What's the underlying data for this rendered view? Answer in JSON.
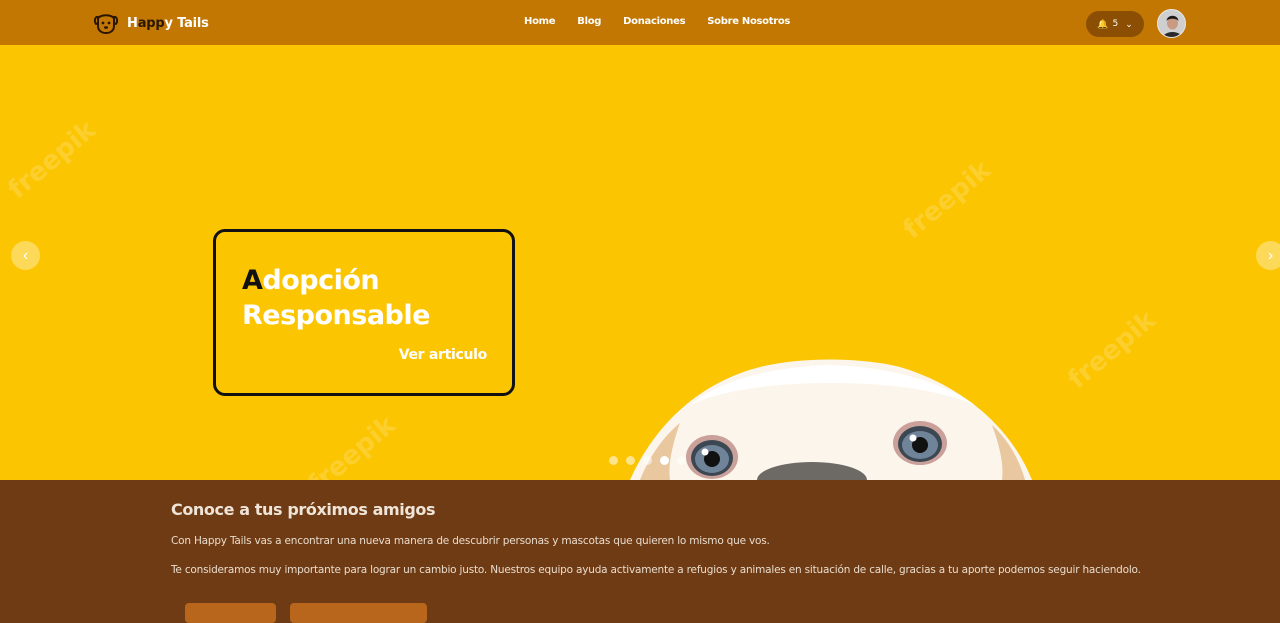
{
  "brand": {
    "name_first": "H",
    "name_middle": "app",
    "name_last": "y Tails",
    "logo_icon": "dog-face-icon"
  },
  "nav": {
    "links": [
      "Home",
      "Blog",
      "Donaciones",
      "Sobre Nosotros"
    ]
  },
  "notifications": {
    "icon": "bell-icon",
    "count": "5",
    "chevron_icon": "chevron-down-icon"
  },
  "user": {
    "avatar_icon": "user-avatar"
  },
  "hero": {
    "title_first_letter": "A",
    "title_line1_rest": "dopción",
    "title_line2": "Responsable",
    "link_label": "Ver articulo",
    "prev_icon": "chevron-left-icon",
    "next_icon": "chevron-right-icon",
    "slide_count": 5,
    "active_slide": 4,
    "watermark": "freepik"
  },
  "about": {
    "title": "Conoce a tus próximos amigos",
    "paragraph1": "Con Happy Tails vas a encontrar una nueva manera de descubrir personas y mascotas que quieren lo mismo que vos.",
    "paragraph2": "Te consideramos muy importante para lograr un cambio justo. Nuestros equipo ayuda activamente a refugios y animales en situación de calle, gracias a tu aporte podemos seguir haciendolo."
  },
  "colors": {
    "navbar": "#c27702",
    "hero_bg": "#fcc501",
    "section_bg": "#6e3b14",
    "notif_bg": "#8b4e03",
    "button_bg": "#b8661b"
  }
}
